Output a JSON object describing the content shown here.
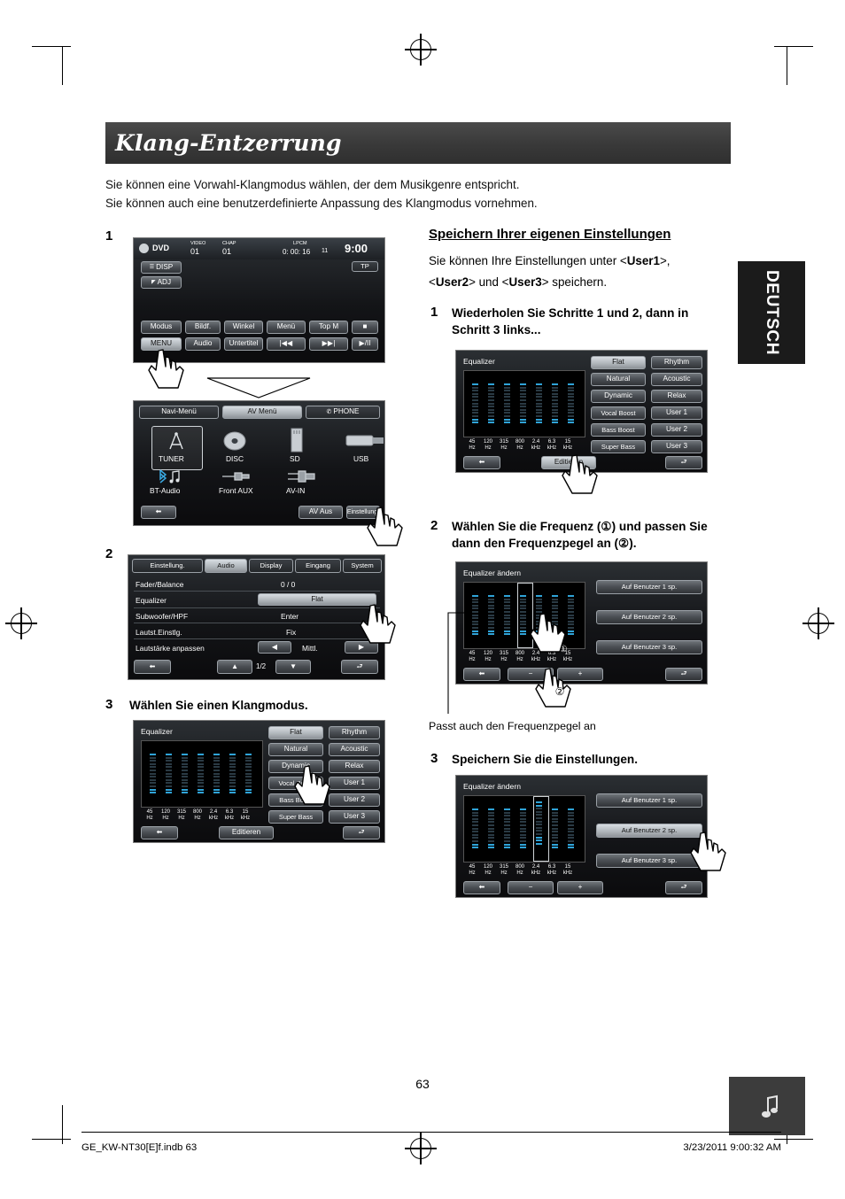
{
  "document": {
    "title": "Klang-Entzerrung",
    "intro_line1": "Sie können eine Vorwahl-Klangmodus wählen, der dem Musikgenre entspricht.",
    "intro_line2": "Sie können auch eine benutzerdefinierte Anpassung des Klangmodus vornehmen.",
    "side_tab": "DEUTSCH",
    "page_number": "63",
    "footer_left": "GE_KW-NT30[E]f.indb   63",
    "footer_right": "3/23/2011   9:00:32 AM"
  },
  "left_column": {
    "step1_num": "1",
    "step2_num": "2",
    "step3_num": "3",
    "step3_text": "Wählen Sie einen Klangmodus."
  },
  "right_column": {
    "heading": "Speichern Ihrer eigenen Einstellungen",
    "para_line1": "Sie können Ihre Einstellungen unter <User1>,",
    "para_line2_a": "<",
    "para_line2_user2": "User2",
    "para_line2_b": "> und <",
    "para_line2_user3": "User3",
    "para_line2_c": "> speichern.",
    "step1_num": "1",
    "step1_text_l1": "Wiederholen Sie Schritte 1 und 2, dann in",
    "step1_text_l2": "Schritt 3 links...",
    "step2_num": "2",
    "step2_text_l1": "Wählen Sie die Frequenz (①) und passen Sie",
    "step2_text_l2": "dann den Frequenzpegel an (②).",
    "caption": "Passt auch den Frequenzpegel an",
    "step3_num": "3",
    "step3_text": "Speichern Sie die Einstellungen."
  },
  "screen_dvd": {
    "source": "DVD",
    "video_label": "VIDEO",
    "video_val": "01",
    "chap_label": "CHAP",
    "chap_val": "01",
    "audio_fmt": "LPCM",
    "clock": "9:00",
    "time": "0: 00: 16",
    "time_suffix": "11",
    "tp": "TP",
    "disp": "DISP",
    "adj": "ADJ",
    "row1": [
      "Modus",
      "Bildf.",
      "Winkel",
      "Menü",
      "Top M",
      "■"
    ],
    "row2": [
      "MENU",
      "Audio",
      "Untertitel"
    ],
    "transport": [
      "|◀◀",
      "▶▶|",
      "▶/II"
    ]
  },
  "screen_av": {
    "tabs": [
      "Navi-Menü",
      "AV Menü",
      "PHONE"
    ],
    "sources": [
      "TUNER",
      "DISC",
      "SD",
      "USB"
    ],
    "sources2": [
      "BT-Audio",
      "Front AUX",
      "AV-IN"
    ],
    "bottom": [
      "AV Aus",
      "Einstellung."
    ]
  },
  "screen_setting": {
    "tabs": [
      "Einstellung.",
      "Audio",
      "Display",
      "Eingang",
      "System"
    ],
    "rows": [
      {
        "label": "Fader/Balance",
        "value": "0 / 0"
      },
      {
        "label": "Equalizer",
        "value": "Flat"
      },
      {
        "label": "Subwoofer/HPF",
        "value": "Enter"
      },
      {
        "label": "Lautst.Einstlg.",
        "value": "Fix"
      },
      {
        "label": "Lautstärke anpassen",
        "value": "Mittl."
      }
    ],
    "page_indicator": "1/2"
  },
  "screen_eq": {
    "title": "Equalizer",
    "presets_col1": [
      "Flat",
      "Natural",
      "Dynamic",
      "Vocal Boost",
      "Bass Boost",
      "Super Bass"
    ],
    "presets_col2": [
      "Rhythm",
      "Acoustic",
      "Relax",
      "User 1",
      "User 2",
      "User 3"
    ],
    "edit_button": "Editieren",
    "frequencies": [
      {
        "num": "45",
        "unit": "Hz"
      },
      {
        "num": "120",
        "unit": "Hz"
      },
      {
        "num": "315",
        "unit": "Hz"
      },
      {
        "num": "800",
        "unit": "Hz"
      },
      {
        "num": "2.4",
        "unit": "kHz"
      },
      {
        "num": "6.3",
        "unit": "kHz"
      },
      {
        "num": "15",
        "unit": "kHz"
      }
    ]
  },
  "screen_eq_edit": {
    "title": "Equalizer ändern",
    "buttons": [
      "Auf Benutzer 1 sp.",
      "Auf Benutzer 2 sp.",
      "Auf Benutzer 3 sp."
    ],
    "minus": "−",
    "plus": "+",
    "marker1": "①",
    "marker2": "②"
  }
}
